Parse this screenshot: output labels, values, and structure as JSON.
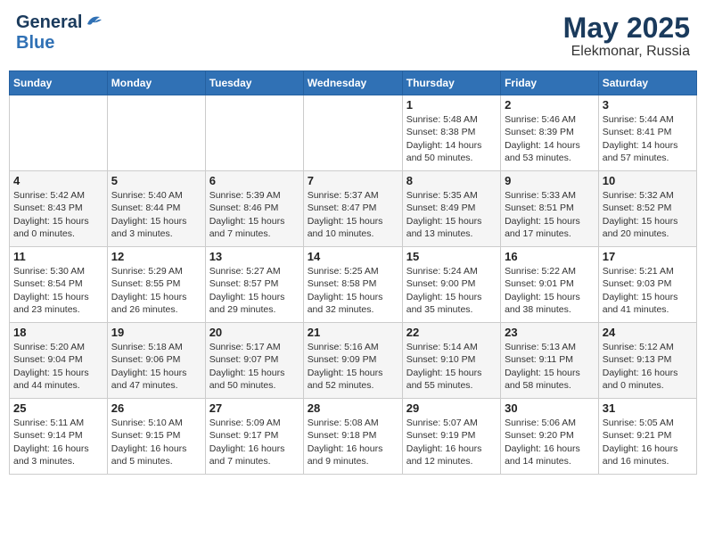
{
  "header": {
    "logo_general": "General",
    "logo_blue": "Blue",
    "month": "May 2025",
    "location": "Elekmonar, Russia"
  },
  "days_of_week": [
    "Sunday",
    "Monday",
    "Tuesday",
    "Wednesday",
    "Thursday",
    "Friday",
    "Saturday"
  ],
  "weeks": [
    [
      {
        "day": "",
        "info": ""
      },
      {
        "day": "",
        "info": ""
      },
      {
        "day": "",
        "info": ""
      },
      {
        "day": "",
        "info": ""
      },
      {
        "day": "1",
        "info": "Sunrise: 5:48 AM\nSunset: 8:38 PM\nDaylight: 14 hours\nand 50 minutes."
      },
      {
        "day": "2",
        "info": "Sunrise: 5:46 AM\nSunset: 8:39 PM\nDaylight: 14 hours\nand 53 minutes."
      },
      {
        "day": "3",
        "info": "Sunrise: 5:44 AM\nSunset: 8:41 PM\nDaylight: 14 hours\nand 57 minutes."
      }
    ],
    [
      {
        "day": "4",
        "info": "Sunrise: 5:42 AM\nSunset: 8:43 PM\nDaylight: 15 hours\nand 0 minutes."
      },
      {
        "day": "5",
        "info": "Sunrise: 5:40 AM\nSunset: 8:44 PM\nDaylight: 15 hours\nand 3 minutes."
      },
      {
        "day": "6",
        "info": "Sunrise: 5:39 AM\nSunset: 8:46 PM\nDaylight: 15 hours\nand 7 minutes."
      },
      {
        "day": "7",
        "info": "Sunrise: 5:37 AM\nSunset: 8:47 PM\nDaylight: 15 hours\nand 10 minutes."
      },
      {
        "day": "8",
        "info": "Sunrise: 5:35 AM\nSunset: 8:49 PM\nDaylight: 15 hours\nand 13 minutes."
      },
      {
        "day": "9",
        "info": "Sunrise: 5:33 AM\nSunset: 8:51 PM\nDaylight: 15 hours\nand 17 minutes."
      },
      {
        "day": "10",
        "info": "Sunrise: 5:32 AM\nSunset: 8:52 PM\nDaylight: 15 hours\nand 20 minutes."
      }
    ],
    [
      {
        "day": "11",
        "info": "Sunrise: 5:30 AM\nSunset: 8:54 PM\nDaylight: 15 hours\nand 23 minutes."
      },
      {
        "day": "12",
        "info": "Sunrise: 5:29 AM\nSunset: 8:55 PM\nDaylight: 15 hours\nand 26 minutes."
      },
      {
        "day": "13",
        "info": "Sunrise: 5:27 AM\nSunset: 8:57 PM\nDaylight: 15 hours\nand 29 minutes."
      },
      {
        "day": "14",
        "info": "Sunrise: 5:25 AM\nSunset: 8:58 PM\nDaylight: 15 hours\nand 32 minutes."
      },
      {
        "day": "15",
        "info": "Sunrise: 5:24 AM\nSunset: 9:00 PM\nDaylight: 15 hours\nand 35 minutes."
      },
      {
        "day": "16",
        "info": "Sunrise: 5:22 AM\nSunset: 9:01 PM\nDaylight: 15 hours\nand 38 minutes."
      },
      {
        "day": "17",
        "info": "Sunrise: 5:21 AM\nSunset: 9:03 PM\nDaylight: 15 hours\nand 41 minutes."
      }
    ],
    [
      {
        "day": "18",
        "info": "Sunrise: 5:20 AM\nSunset: 9:04 PM\nDaylight: 15 hours\nand 44 minutes."
      },
      {
        "day": "19",
        "info": "Sunrise: 5:18 AM\nSunset: 9:06 PM\nDaylight: 15 hours\nand 47 minutes."
      },
      {
        "day": "20",
        "info": "Sunrise: 5:17 AM\nSunset: 9:07 PM\nDaylight: 15 hours\nand 50 minutes."
      },
      {
        "day": "21",
        "info": "Sunrise: 5:16 AM\nSunset: 9:09 PM\nDaylight: 15 hours\nand 52 minutes."
      },
      {
        "day": "22",
        "info": "Sunrise: 5:14 AM\nSunset: 9:10 PM\nDaylight: 15 hours\nand 55 minutes."
      },
      {
        "day": "23",
        "info": "Sunrise: 5:13 AM\nSunset: 9:11 PM\nDaylight: 15 hours\nand 58 minutes."
      },
      {
        "day": "24",
        "info": "Sunrise: 5:12 AM\nSunset: 9:13 PM\nDaylight: 16 hours\nand 0 minutes."
      }
    ],
    [
      {
        "day": "25",
        "info": "Sunrise: 5:11 AM\nSunset: 9:14 PM\nDaylight: 16 hours\nand 3 minutes."
      },
      {
        "day": "26",
        "info": "Sunrise: 5:10 AM\nSunset: 9:15 PM\nDaylight: 16 hours\nand 5 minutes."
      },
      {
        "day": "27",
        "info": "Sunrise: 5:09 AM\nSunset: 9:17 PM\nDaylight: 16 hours\nand 7 minutes."
      },
      {
        "day": "28",
        "info": "Sunrise: 5:08 AM\nSunset: 9:18 PM\nDaylight: 16 hours\nand 9 minutes."
      },
      {
        "day": "29",
        "info": "Sunrise: 5:07 AM\nSunset: 9:19 PM\nDaylight: 16 hours\nand 12 minutes."
      },
      {
        "day": "30",
        "info": "Sunrise: 5:06 AM\nSunset: 9:20 PM\nDaylight: 16 hours\nand 14 minutes."
      },
      {
        "day": "31",
        "info": "Sunrise: 5:05 AM\nSunset: 9:21 PM\nDaylight: 16 hours\nand 16 minutes."
      }
    ]
  ]
}
